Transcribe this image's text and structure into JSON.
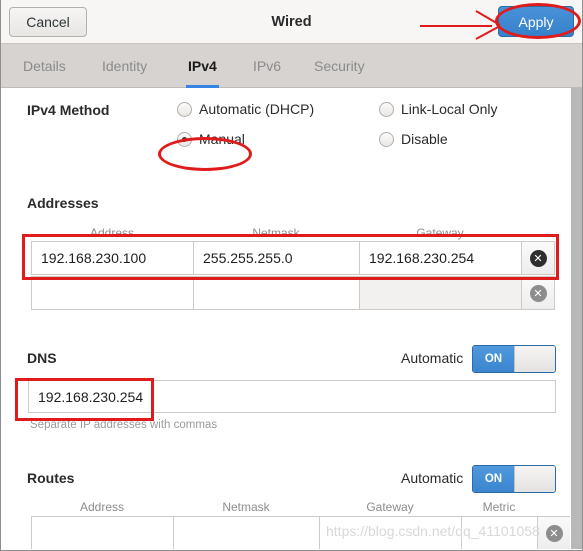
{
  "window": {
    "title": "Wired",
    "cancel_label": "Cancel",
    "apply_label": "Apply"
  },
  "tabs": [
    {
      "label": "Details",
      "active": false
    },
    {
      "label": "Identity",
      "active": false
    },
    {
      "label": "IPv4",
      "active": true
    },
    {
      "label": "IPv6",
      "active": false
    },
    {
      "label": "Security",
      "active": false
    }
  ],
  "ipv4_method": {
    "label": "IPv4 Method",
    "options": [
      {
        "label": "Automatic (DHCP)",
        "selected": false
      },
      {
        "label": "Manual",
        "selected": true
      },
      {
        "label": "Link-Local Only",
        "selected": false
      },
      {
        "label": "Disable",
        "selected": false
      }
    ]
  },
  "addresses": {
    "label": "Addresses",
    "columns": [
      "Address",
      "Netmask",
      "Gateway"
    ],
    "rows": [
      {
        "address": "192.168.230.100",
        "netmask": "255.255.255.0",
        "gateway": "192.168.230.254",
        "gateway_disabled": false,
        "delete_icon": "delete-circle-icon"
      },
      {
        "address": "",
        "netmask": "",
        "gateway": "",
        "gateway_disabled": true,
        "delete_icon": "delete-circle-icon"
      }
    ]
  },
  "dns": {
    "label": "DNS",
    "automatic_label": "Automatic",
    "toggle_state": "ON",
    "value": "192.168.230.254",
    "hint": "Separate IP addresses with commas"
  },
  "routes": {
    "label": "Routes",
    "automatic_label": "Automatic",
    "toggle_state": "ON",
    "columns": [
      "Address",
      "Netmask",
      "Gateway",
      "Metric"
    ],
    "rows": [
      {
        "address": "",
        "netmask": "",
        "gateway": "",
        "metric": "",
        "delete_icon": "delete-circle-icon"
      }
    ]
  },
  "icons": {
    "delete": "✕"
  },
  "watermark": {
    "text": "https://blog.csdn.net/qq_41101058"
  },
  "colors": {
    "accent_blue": "#3584e4",
    "annotation_red": "#e01b1b",
    "tabbar_gray": "#d6d3d0",
    "toggle_blue": "#3b85cf"
  }
}
